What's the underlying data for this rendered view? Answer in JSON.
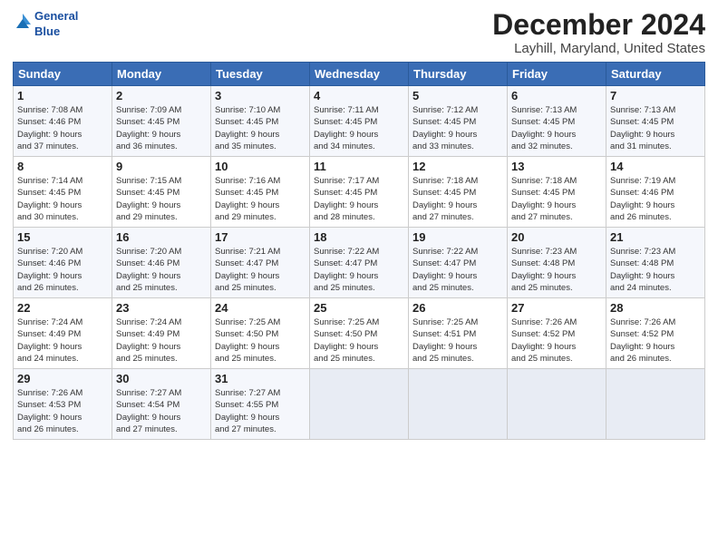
{
  "logo": {
    "line1": "General",
    "line2": "Blue"
  },
  "title": "December 2024",
  "subtitle": "Layhill, Maryland, United States",
  "headers": [
    "Sunday",
    "Monday",
    "Tuesday",
    "Wednesday",
    "Thursday",
    "Friday",
    "Saturday"
  ],
  "weeks": [
    [
      {
        "day": "1",
        "info": "Sunrise: 7:08 AM\nSunset: 4:46 PM\nDaylight: 9 hours\nand 37 minutes."
      },
      {
        "day": "2",
        "info": "Sunrise: 7:09 AM\nSunset: 4:45 PM\nDaylight: 9 hours\nand 36 minutes."
      },
      {
        "day": "3",
        "info": "Sunrise: 7:10 AM\nSunset: 4:45 PM\nDaylight: 9 hours\nand 35 minutes."
      },
      {
        "day": "4",
        "info": "Sunrise: 7:11 AM\nSunset: 4:45 PM\nDaylight: 9 hours\nand 34 minutes."
      },
      {
        "day": "5",
        "info": "Sunrise: 7:12 AM\nSunset: 4:45 PM\nDaylight: 9 hours\nand 33 minutes."
      },
      {
        "day": "6",
        "info": "Sunrise: 7:13 AM\nSunset: 4:45 PM\nDaylight: 9 hours\nand 32 minutes."
      },
      {
        "day": "7",
        "info": "Sunrise: 7:13 AM\nSunset: 4:45 PM\nDaylight: 9 hours\nand 31 minutes."
      }
    ],
    [
      {
        "day": "8",
        "info": "Sunrise: 7:14 AM\nSunset: 4:45 PM\nDaylight: 9 hours\nand 30 minutes."
      },
      {
        "day": "9",
        "info": "Sunrise: 7:15 AM\nSunset: 4:45 PM\nDaylight: 9 hours\nand 29 minutes."
      },
      {
        "day": "10",
        "info": "Sunrise: 7:16 AM\nSunset: 4:45 PM\nDaylight: 9 hours\nand 29 minutes."
      },
      {
        "day": "11",
        "info": "Sunrise: 7:17 AM\nSunset: 4:45 PM\nDaylight: 9 hours\nand 28 minutes."
      },
      {
        "day": "12",
        "info": "Sunrise: 7:18 AM\nSunset: 4:45 PM\nDaylight: 9 hours\nand 27 minutes."
      },
      {
        "day": "13",
        "info": "Sunrise: 7:18 AM\nSunset: 4:45 PM\nDaylight: 9 hours\nand 27 minutes."
      },
      {
        "day": "14",
        "info": "Sunrise: 7:19 AM\nSunset: 4:46 PM\nDaylight: 9 hours\nand 26 minutes."
      }
    ],
    [
      {
        "day": "15",
        "info": "Sunrise: 7:20 AM\nSunset: 4:46 PM\nDaylight: 9 hours\nand 26 minutes."
      },
      {
        "day": "16",
        "info": "Sunrise: 7:20 AM\nSunset: 4:46 PM\nDaylight: 9 hours\nand 25 minutes."
      },
      {
        "day": "17",
        "info": "Sunrise: 7:21 AM\nSunset: 4:47 PM\nDaylight: 9 hours\nand 25 minutes."
      },
      {
        "day": "18",
        "info": "Sunrise: 7:22 AM\nSunset: 4:47 PM\nDaylight: 9 hours\nand 25 minutes."
      },
      {
        "day": "19",
        "info": "Sunrise: 7:22 AM\nSunset: 4:47 PM\nDaylight: 9 hours\nand 25 minutes."
      },
      {
        "day": "20",
        "info": "Sunrise: 7:23 AM\nSunset: 4:48 PM\nDaylight: 9 hours\nand 25 minutes."
      },
      {
        "day": "21",
        "info": "Sunrise: 7:23 AM\nSunset: 4:48 PM\nDaylight: 9 hours\nand 24 minutes."
      }
    ],
    [
      {
        "day": "22",
        "info": "Sunrise: 7:24 AM\nSunset: 4:49 PM\nDaylight: 9 hours\nand 24 minutes."
      },
      {
        "day": "23",
        "info": "Sunrise: 7:24 AM\nSunset: 4:49 PM\nDaylight: 9 hours\nand 25 minutes."
      },
      {
        "day": "24",
        "info": "Sunrise: 7:25 AM\nSunset: 4:50 PM\nDaylight: 9 hours\nand 25 minutes."
      },
      {
        "day": "25",
        "info": "Sunrise: 7:25 AM\nSunset: 4:50 PM\nDaylight: 9 hours\nand 25 minutes."
      },
      {
        "day": "26",
        "info": "Sunrise: 7:25 AM\nSunset: 4:51 PM\nDaylight: 9 hours\nand 25 minutes."
      },
      {
        "day": "27",
        "info": "Sunrise: 7:26 AM\nSunset: 4:52 PM\nDaylight: 9 hours\nand 25 minutes."
      },
      {
        "day": "28",
        "info": "Sunrise: 7:26 AM\nSunset: 4:52 PM\nDaylight: 9 hours\nand 26 minutes."
      }
    ],
    [
      {
        "day": "29",
        "info": "Sunrise: 7:26 AM\nSunset: 4:53 PM\nDaylight: 9 hours\nand 26 minutes."
      },
      {
        "day": "30",
        "info": "Sunrise: 7:27 AM\nSunset: 4:54 PM\nDaylight: 9 hours\nand 27 minutes."
      },
      {
        "day": "31",
        "info": "Sunrise: 7:27 AM\nSunset: 4:55 PM\nDaylight: 9 hours\nand 27 minutes."
      },
      {
        "day": "",
        "info": ""
      },
      {
        "day": "",
        "info": ""
      },
      {
        "day": "",
        "info": ""
      },
      {
        "day": "",
        "info": ""
      }
    ]
  ]
}
